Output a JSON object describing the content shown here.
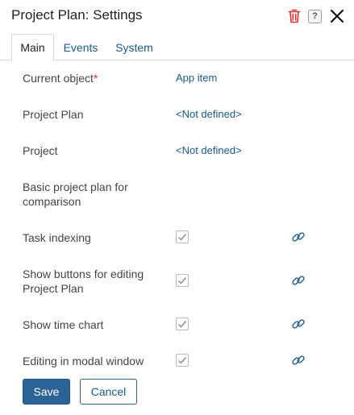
{
  "dialog": {
    "title": "Project Plan: Settings",
    "header_icons": [
      "trash-icon",
      "help-icon",
      "close-icon"
    ],
    "help_glyph": "?"
  },
  "tabs": [
    {
      "label": "Main",
      "active": true
    },
    {
      "label": "Events",
      "active": false
    },
    {
      "label": "System",
      "active": false
    }
  ],
  "fields": {
    "current_object": {
      "label": "Current object",
      "required_mark": "*",
      "value": "App item"
    },
    "project_plan": {
      "label": "Project Plan",
      "value": "<Not defined>"
    },
    "project": {
      "label": "Project",
      "value": "<Not defined>"
    },
    "basic_plan": {
      "label": "Basic project plan for comparison"
    },
    "task_indexing": {
      "label": "Task indexing",
      "checked": true
    },
    "show_buttons": {
      "label": "Show buttons for editing Project Plan",
      "checked": true
    },
    "show_time_chart": {
      "label": "Show time chart",
      "checked": true
    },
    "editing_modal": {
      "label": "Editing in modal window",
      "checked": true
    }
  },
  "buttons": {
    "save": "Save",
    "cancel": "Cancel"
  },
  "colors": {
    "primary": "#2b6396",
    "link": "#1a5a8a",
    "delete": "#d9342b",
    "required": "#d9342b"
  }
}
